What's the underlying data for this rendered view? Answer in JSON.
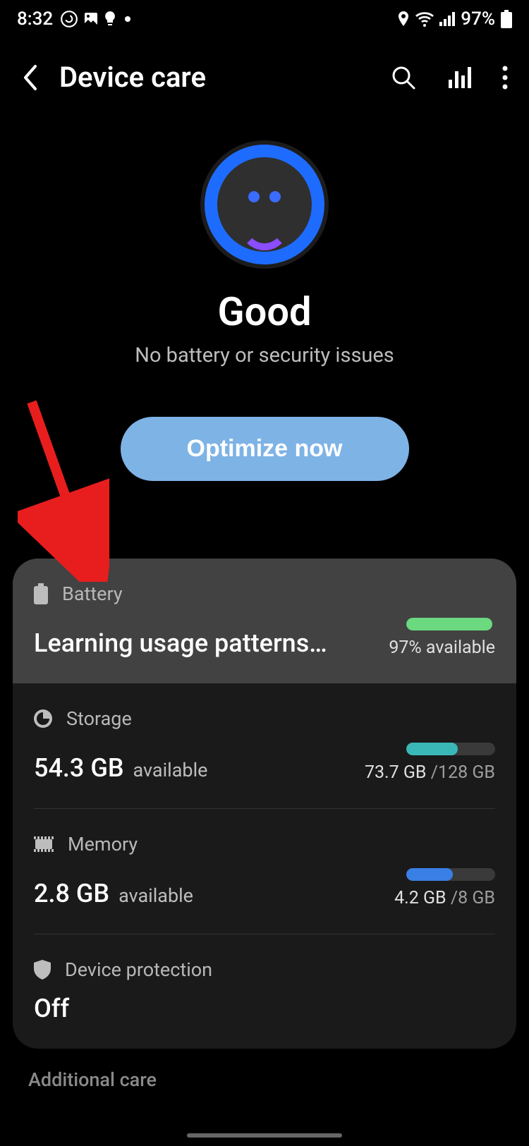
{
  "status_bar": {
    "time": "8:32",
    "battery_percent": "97%"
  },
  "header": {
    "title": "Device care"
  },
  "hero": {
    "status": "Good",
    "subtitle": "No battery or security issues",
    "optimize_label": "Optimize now"
  },
  "battery": {
    "label": "Battery",
    "status": "Learning usage patterns…",
    "available": "97% available",
    "fill_percent": 97
  },
  "storage": {
    "label": "Storage",
    "value": "54.3 GB",
    "value_suffix": "available",
    "used": "73.7 GB",
    "total": "/128 GB",
    "fill_percent": 58
  },
  "memory": {
    "label": "Memory",
    "value": "2.8 GB",
    "value_suffix": "available",
    "used": "4.2 GB",
    "total": "/8 GB",
    "fill_percent": 52
  },
  "protection": {
    "label": "Device protection",
    "status": "Off"
  },
  "additional": {
    "title": "Additional care"
  }
}
